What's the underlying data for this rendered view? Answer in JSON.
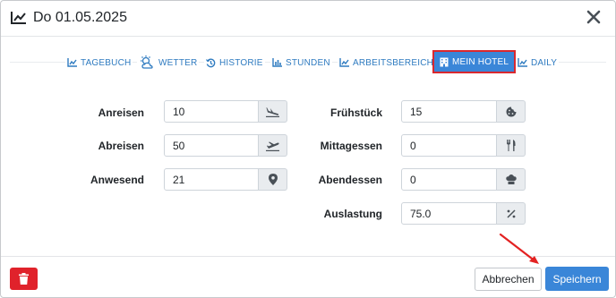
{
  "dialog": {
    "title": "Do 01.05.2025"
  },
  "tabs": [
    {
      "label": "TAGEBUCH",
      "icon": "line-chart-icon"
    },
    {
      "label": "WETTER",
      "icon": "weather-icon"
    },
    {
      "label": "HISTORIE",
      "icon": "history-icon"
    },
    {
      "label": "STUNDEN",
      "icon": "bar-chart-icon"
    },
    {
      "label": "ARBEITSBEREICHE",
      "icon": "line-chart-icon"
    },
    {
      "label": "MEIN HOTEL",
      "icon": "hotel-icon",
      "active": true
    },
    {
      "label": "DAILY",
      "icon": "line-chart-icon"
    }
  ],
  "form": {
    "left": [
      {
        "label": "Anreisen",
        "value": "10",
        "icon": "plane-landing-icon"
      },
      {
        "label": "Abreisen",
        "value": "50",
        "icon": "plane-departure-icon"
      },
      {
        "label": "Anwesend",
        "value": "21",
        "icon": "map-pin-icon"
      }
    ],
    "right": [
      {
        "label": "Frühstück",
        "value": "15",
        "icon": "cookie-icon"
      },
      {
        "label": "Mittagessen",
        "value": "0",
        "icon": "cutlery-icon"
      },
      {
        "label": "Abendessen",
        "value": "0",
        "icon": "chef-hat-icon"
      },
      {
        "label": "Auslastung",
        "value": "75.0",
        "icon": "percent-icon"
      }
    ]
  },
  "footer": {
    "cancel_label": "Abbrechen",
    "save_label": "Speichern"
  },
  "colors": {
    "accent": "#3a86d8",
    "tab_text": "#2f7bc0",
    "danger": "#e0222b",
    "highlight": "#d9282f"
  }
}
